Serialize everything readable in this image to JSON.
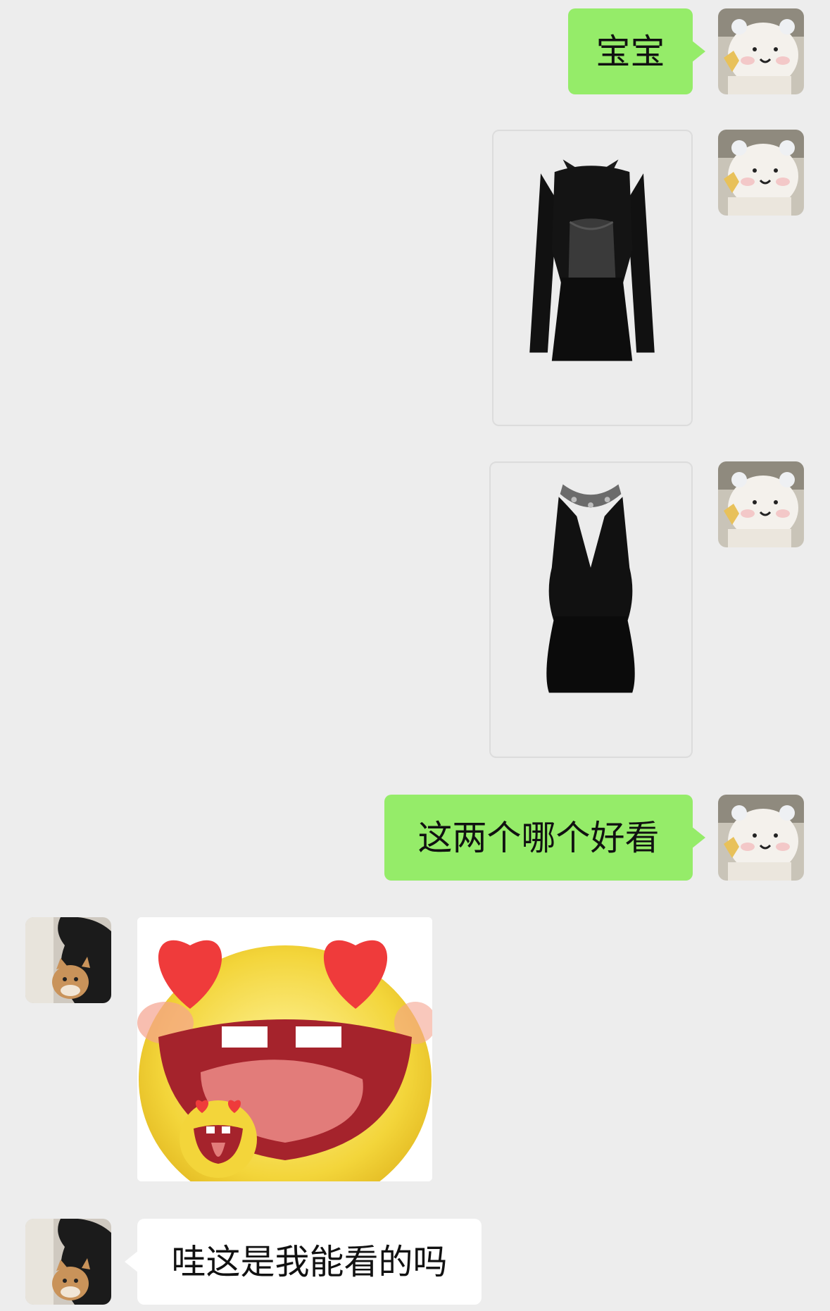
{
  "chat": {
    "messages": [
      {
        "side": "right",
        "type": "text",
        "text": "宝宝"
      },
      {
        "side": "right",
        "type": "image",
        "image_desc": "black-lace-long-sleeve-dress"
      },
      {
        "side": "right",
        "type": "image",
        "image_desc": "black-halter-dress-with-jeweled-neck"
      },
      {
        "side": "right",
        "type": "text",
        "text": "这两个哪个好看"
      },
      {
        "side": "left",
        "type": "sticker",
        "image_desc": "heart-eyes-tongue-out-emoji"
      },
      {
        "side": "left",
        "type": "text",
        "text": "哇这是我能看的吗"
      }
    ]
  },
  "colors": {
    "background": "#ededed",
    "bubble_self": "#95ec69",
    "bubble_other": "#ffffff"
  },
  "icons": {
    "self_avatar": "white-bear-plush-avatar",
    "other_avatar": "person-with-cat-avatar"
  }
}
